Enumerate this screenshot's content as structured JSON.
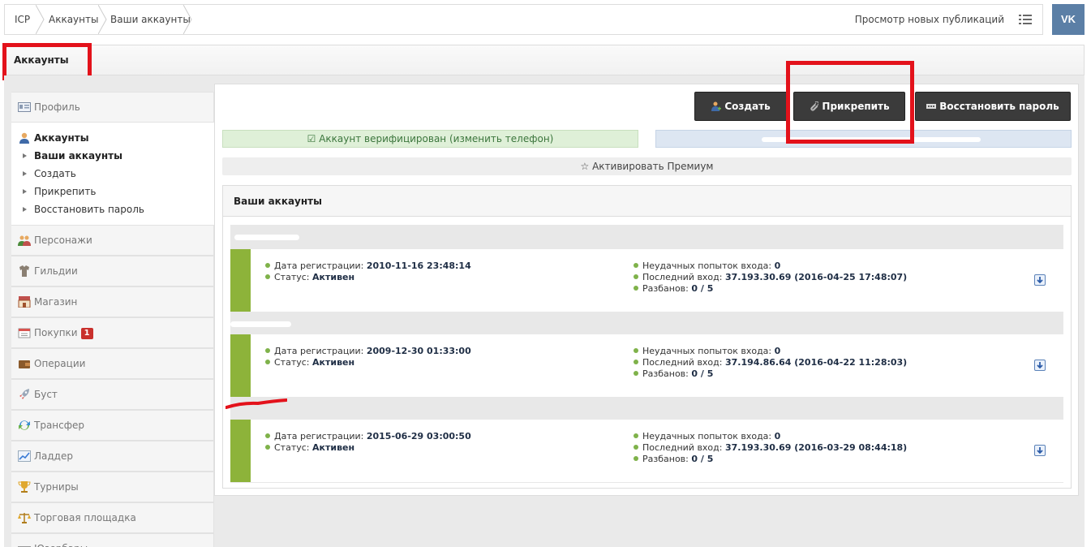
{
  "breadcrumb": [
    "ICP",
    "Аккаунты",
    "Ваши аккаунты"
  ],
  "topbar": {
    "link": "Просмотр новых публикаций",
    "vk_label": "VK"
  },
  "section_title": "Аккаунты",
  "sidebar": {
    "profile": "Профиль",
    "active_section": "Аккаунты",
    "subitems": [
      "Ваши аккаунты",
      "Создать",
      "Прикрепить",
      "Восстановить пароль"
    ],
    "items": [
      {
        "label": "Персонажи",
        "icon": "characters-icon"
      },
      {
        "label": "Гильдии",
        "icon": "guild-icon"
      },
      {
        "label": "Магазин",
        "icon": "shop-icon"
      },
      {
        "label": "Покупки",
        "icon": "purchases-icon",
        "badge": "1"
      },
      {
        "label": "Операции",
        "icon": "wallet-icon"
      },
      {
        "label": "Буст",
        "icon": "rocket-icon"
      },
      {
        "label": "Трансфер",
        "icon": "transfer-icon"
      },
      {
        "label": "Ладдер",
        "icon": "ladder-icon"
      },
      {
        "label": "Турниры",
        "icon": "trophy-icon"
      },
      {
        "label": "Торговая площадка",
        "icon": "scales-icon"
      },
      {
        "label": "Юзербары",
        "icon": "userbar-icon"
      }
    ]
  },
  "actions": {
    "create": "Создать",
    "attach": "Прикрепить",
    "restore": "Восстановить пароль"
  },
  "verified_text": "Аккаунт верифицирован (изменить телефон)",
  "premium_text": "Активировать Премиум",
  "accounts_title": "Ваши аккаунты",
  "labels": {
    "reg_date": "Дата регистрации:",
    "status": "Статус:",
    "failed": "Неудачных попыток входа:",
    "last_login": "Последний вход:",
    "unbans": "Разбанов:"
  },
  "accounts": [
    {
      "reg_date": "2010-11-16 23:48:14",
      "status": "Активен",
      "failed": "0",
      "last_login": "37.193.30.69 (2016-04-25 17:48:07)",
      "unbans": "0 / 5"
    },
    {
      "reg_date": "2009-12-30 01:33:00",
      "status": "Активен",
      "failed": "0",
      "last_login": "37.194.86.64 (2016-04-22 11:28:03)",
      "unbans": "0 / 5"
    },
    {
      "reg_date": "2015-06-29 03:00:50",
      "status": "Активен",
      "failed": "0",
      "last_login": "37.193.30.69 (2016-03-29 08:44:18)",
      "unbans": "0 / 5"
    }
  ]
}
